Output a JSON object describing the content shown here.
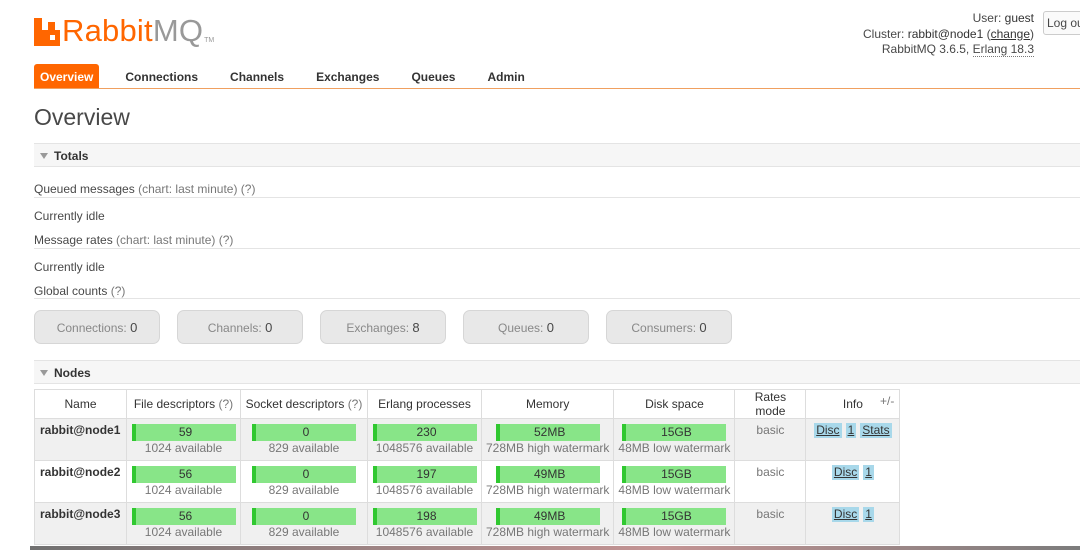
{
  "header": {
    "logo_rabbit": "Rabbit",
    "logo_mq": "MQ",
    "logo_tm": "TM",
    "user_label": "User:",
    "user_value": "guest",
    "cluster_label": "Cluster:",
    "cluster_value": "rabbit@node1",
    "change_link": "change",
    "version_label": "RabbitMQ 3.6.5,",
    "erlang_label": "Erlang 18.3",
    "logout_label": "Log out"
  },
  "tabs": [
    {
      "label": "Overview",
      "active": true
    },
    {
      "label": "Connections"
    },
    {
      "label": "Channels"
    },
    {
      "label": "Exchanges"
    },
    {
      "label": "Queues"
    },
    {
      "label": "Admin"
    }
  ],
  "page_title": "Overview",
  "totals": {
    "section_title": "Totals",
    "queued_label": "Queued messages",
    "queued_sub": "(chart: last minute) (?)",
    "queued_status": "Currently idle",
    "rates_label": "Message rates",
    "rates_sub": "(chart: last minute) (?)",
    "rates_status": "Currently idle",
    "global_label": "Global counts",
    "global_sub": "(?)",
    "counts": [
      {
        "label": "Connections:",
        "value": "0"
      },
      {
        "label": "Channels:",
        "value": "0"
      },
      {
        "label": "Exchanges:",
        "value": "8"
      },
      {
        "label": "Queues:",
        "value": "0"
      },
      {
        "label": "Consumers:",
        "value": "0"
      }
    ]
  },
  "nodes": {
    "section_title": "Nodes",
    "plusminus": "+/-",
    "headers": {
      "name": "Name",
      "fd": "File descriptors",
      "fd_q": "(?)",
      "sd": "Socket descriptors",
      "sd_q": "(?)",
      "erl": "Erlang processes",
      "mem": "Memory",
      "disk": "Disk space",
      "rates": "Rates mode",
      "info": "Info"
    },
    "rows": [
      {
        "name": "rabbit@node1",
        "fd": "59",
        "fd_sub": "1024 available",
        "sd": "0",
        "sd_sub": "829 available",
        "erl": "230",
        "erl_sub": "1048576 available",
        "mem": "52MB",
        "mem_sub": "728MB high watermark",
        "disk": "15GB",
        "disk_sub": "48MB low watermark",
        "rates": "basic",
        "info": [
          "Disc",
          "1",
          "Stats"
        ]
      },
      {
        "name": "rabbit@node2",
        "fd": "56",
        "fd_sub": "1024 available",
        "sd": "0",
        "sd_sub": "829 available",
        "erl": "197",
        "erl_sub": "1048576 available",
        "mem": "49MB",
        "mem_sub": "728MB high watermark",
        "disk": "15GB",
        "disk_sub": "48MB low watermark",
        "rates": "basic",
        "info": [
          "Disc",
          "1"
        ]
      },
      {
        "name": "rabbit@node3",
        "fd": "56",
        "fd_sub": "1024 available",
        "sd": "0",
        "sd_sub": "829 available",
        "erl": "198",
        "erl_sub": "1048576 available",
        "mem": "49MB",
        "mem_sub": "728MB high watermark",
        "disk": "15GB",
        "disk_sub": "48MB low watermark",
        "rates": "basic",
        "info": [
          "Disc",
          "1"
        ]
      }
    ]
  },
  "colors": {
    "accent": "#ff6600",
    "bar_fill": "#88e588",
    "bar_edge": "#30c830",
    "badge": "#a8d8ea"
  }
}
